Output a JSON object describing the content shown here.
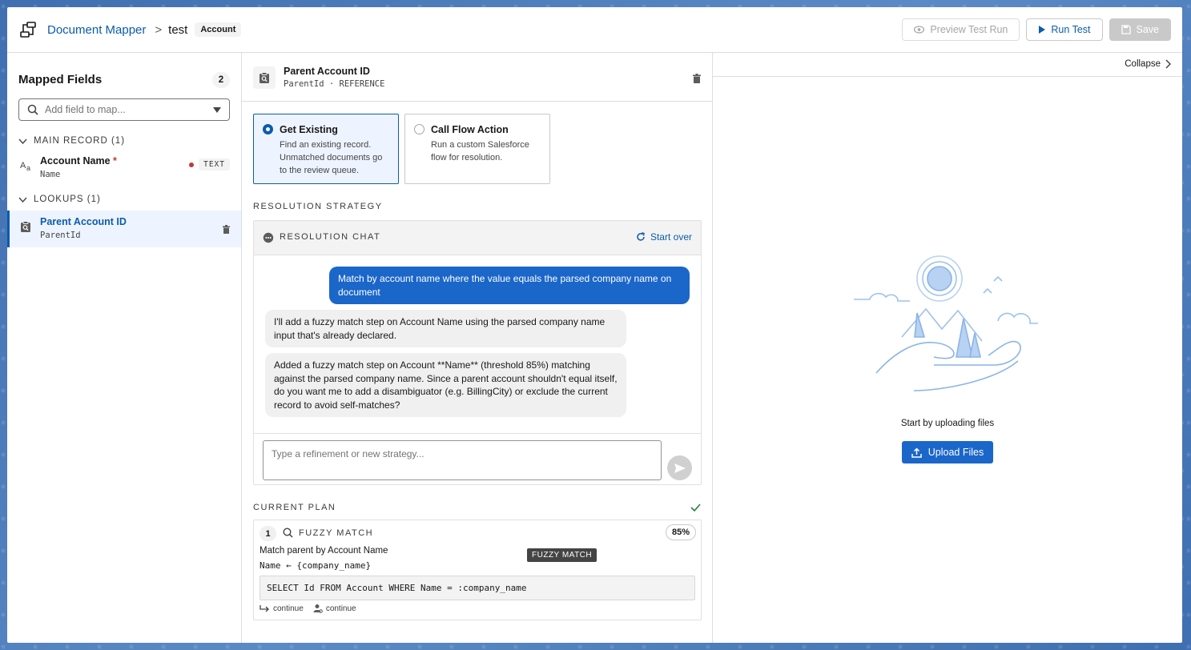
{
  "header": {
    "app_name": "Document Mapper",
    "breadcrumb_sep": ">",
    "mapping_name": "test",
    "object_badge": "Account",
    "preview_label": "Preview Test Run",
    "run_label": "Run Test",
    "save_label": "Save"
  },
  "left": {
    "title": "Mapped Fields",
    "count": "2",
    "search_placeholder": "Add field to map...",
    "main_section": "MAIN RECORD (1)",
    "lookups_section": "LOOKUPS (1)",
    "fields": [
      {
        "name": "Account Name",
        "required_mark": "*",
        "api": "Name",
        "type": "TEXT"
      },
      {
        "name": "Parent Account ID",
        "api": "ParentId"
      }
    ]
  },
  "center": {
    "field_title": "Parent Account ID",
    "field_sub": "ParentId · REFERENCE",
    "options": [
      {
        "name": "Get Existing",
        "desc": "Find an existing record. Unmatched documents go to the review queue.",
        "selected": true
      },
      {
        "name": "Call Flow Action",
        "desc": "Run a custom Salesforce flow for resolution.",
        "selected": false
      }
    ],
    "strategy_label": "RESOLUTION STRATEGY",
    "chat": {
      "title": "RESOLUTION CHAT",
      "start_over": "Start over",
      "messages": [
        "Match by account name where the value equals the parsed company name on document",
        "I'll add a fuzzy match step on Account Name using the parsed company name input that's already declared.",
        "Added a fuzzy match step on Account **Name** (threshold 85%) matching against the parsed company name. Since a parent account shouldn't equal itself, do you want me to add a disambiguator (e.g. BillingCity) or exclude the current record to avoid self-matches?"
      ],
      "input_placeholder": "Type a refinement or new strategy..."
    },
    "plan_label": "CURRENT PLAN",
    "step": {
      "number": "1",
      "type": "FUZZY MATCH",
      "threshold": "85%",
      "description": "Match parent by Account Name",
      "mapping": "Name ← {company_name}",
      "tooltip": "FUZZY MATCH",
      "query": "SELECT Id FROM Account WHERE Name = :company_name",
      "outcome_1": "continue",
      "outcome_2": "continue"
    }
  },
  "right": {
    "collapse_label": "Collapse",
    "empty_message": "Start by uploading files",
    "upload_label": "Upload Files"
  },
  "colors": {
    "brand": "#0b5cab",
    "user_bubble": "#1b66c9",
    "required": "#c23934",
    "check": "#2e844a"
  }
}
